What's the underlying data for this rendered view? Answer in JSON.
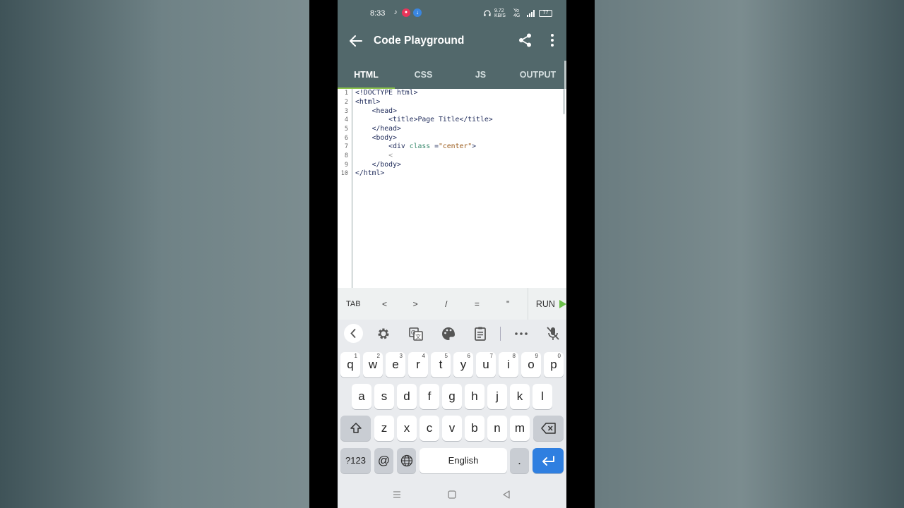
{
  "status_bar": {
    "time": "8:33",
    "icons_left": [
      "music-note-icon",
      "record-icon",
      "download-icon"
    ],
    "net_speed": "9.72 KB/S",
    "network": "Yo 4G",
    "battery": "77"
  },
  "app_bar": {
    "title": "Code Playground",
    "back_icon": "arrow-left-icon",
    "share_icon": "share-icon",
    "more_icon": "more-vertical-icon"
  },
  "tabs": [
    {
      "label": "HTML",
      "active": true
    },
    {
      "label": "CSS",
      "active": false
    },
    {
      "label": "JS",
      "active": false
    },
    {
      "label": "OUTPUT",
      "active": false
    }
  ],
  "editor": {
    "line_numbers": [
      "1",
      "2",
      "3",
      "4",
      "5",
      "6",
      "7",
      "8",
      "9",
      "10"
    ],
    "lines": [
      {
        "a": "<!DOCTYPE html>"
      },
      {
        "a": "<html>"
      },
      {
        "a": "    <head>"
      },
      {
        "a": "        <title>Page Title</title>"
      },
      {
        "a": "    </head>"
      },
      {
        "a": "    <body>"
      },
      {
        "a": "        <div ",
        "b": "class",
        "c": " =",
        "d": "\"center\"",
        "e": ">"
      },
      {
        "a": "        <"
      },
      {
        "a": "    </body>"
      },
      {
        "a": "</html>"
      }
    ]
  },
  "helper_bar": {
    "keys": [
      "TAB",
      "<",
      ">",
      "/",
      "=",
      "\""
    ],
    "run_label": "RUN"
  },
  "keyboard": {
    "toolbar_icons": [
      "chevron-left-icon",
      "gear-icon",
      "translate-icon",
      "palette-icon",
      "clipboard-icon",
      "more-horizontal-icon",
      "mic-off-icon"
    ],
    "row1": [
      {
        "k": "q",
        "h": "1"
      },
      {
        "k": "w",
        "h": "2"
      },
      {
        "k": "e",
        "h": "3"
      },
      {
        "k": "r",
        "h": "4"
      },
      {
        "k": "t",
        "h": "5"
      },
      {
        "k": "y",
        "h": "6"
      },
      {
        "k": "u",
        "h": "7"
      },
      {
        "k": "i",
        "h": "8"
      },
      {
        "k": "o",
        "h": "9"
      },
      {
        "k": "p",
        "h": "0"
      }
    ],
    "row2": [
      "a",
      "s",
      "d",
      "f",
      "g",
      "h",
      "j",
      "k",
      "l"
    ],
    "row3": [
      "z",
      "x",
      "c",
      "v",
      "b",
      "n",
      "m"
    ],
    "row4": {
      "symbols": "?123",
      "at": "@",
      "space": "English",
      "period": "."
    }
  },
  "nav_bar": {
    "icons": [
      "recents-icon",
      "home-icon",
      "back-triangle-icon"
    ]
  },
  "colors": {
    "app_bar": "#52686b",
    "tab_indicator": "#8bc34a",
    "run": "#6cc04a",
    "enter_key": "#2f7fe0"
  }
}
